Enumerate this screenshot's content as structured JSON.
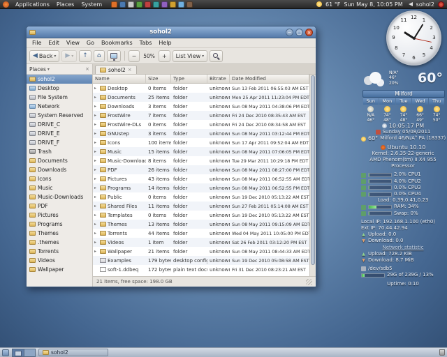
{
  "icons": {
    "minimize": "−",
    "maximize": "□",
    "close": "×",
    "expander": "▸",
    "back": "◀",
    "forward": "▶",
    "up": "↑",
    "home": "⌂",
    "zoom_out": "−",
    "zoom_in": "+",
    "dropdown": "▾",
    "tab_close": "×",
    "places_close": "×",
    "net_up": "▲",
    "net_down": "▼"
  },
  "top_panel": {
    "menus": [
      "Applications",
      "Places",
      "System"
    ],
    "app_icons": [
      {
        "name": "app-launcher-1",
        "color": "#e07028"
      },
      {
        "name": "app-launcher-2",
        "color": "#4a79b0"
      },
      {
        "name": "app-launcher-3",
        "color": "#c8c8c8"
      },
      {
        "name": "app-launcher-4",
        "color": "#58a040"
      },
      {
        "name": "app-launcher-5",
        "color": "#c04040"
      },
      {
        "name": "app-launcher-6",
        "color": "#38a0a0"
      },
      {
        "name": "app-launcher-7",
        "color": "#9060c0"
      },
      {
        "name": "app-launcher-8",
        "color": "#d0a030"
      },
      {
        "name": "app-launcher-9",
        "color": "#70b0e0"
      },
      {
        "name": "app-launcher-10",
        "color": "#806048"
      }
    ],
    "right": {
      "temperature": "61 °F",
      "clock": "Sun May 8, 10:05 PM",
      "user": "sohol2"
    }
  },
  "window": {
    "title": "sohol2",
    "menubar": [
      "File",
      "Edit",
      "View",
      "Go",
      "Bookmarks",
      "Tabs",
      "Help"
    ],
    "toolbar": {
      "back_label": "Back",
      "zoom_level": "50%",
      "view_mode": "List View"
    },
    "sidebar": {
      "header": "Places",
      "items": [
        {
          "label": "sohol2",
          "icon": "home",
          "selected": true
        },
        {
          "label": "Desktop",
          "icon": "desktop"
        },
        {
          "label": "File System",
          "icon": "drive"
        },
        {
          "label": "Network",
          "icon": "network"
        },
        {
          "label": "System Reserved",
          "icon": "drive"
        },
        {
          "label": "DRIVE_C",
          "icon": "drive"
        },
        {
          "label": "DRIVE_E",
          "icon": "drive"
        },
        {
          "label": "DRIVE_F",
          "icon": "drive"
        },
        {
          "label": "Trash",
          "icon": "trash"
        },
        {
          "label": "Documents",
          "icon": "folder"
        },
        {
          "label": "Downloads",
          "icon": "folder"
        },
        {
          "label": "Icons",
          "icon": "folder"
        },
        {
          "label": "Music",
          "icon": "folder"
        },
        {
          "label": "Music-Downloads",
          "icon": "folder"
        },
        {
          "label": "PDF",
          "icon": "folder"
        },
        {
          "label": "Pictures",
          "icon": "folder"
        },
        {
          "label": "Programs",
          "icon": "folder"
        },
        {
          "label": "Themes",
          "icon": "folder"
        },
        {
          "label": ".themes",
          "icon": "folder"
        },
        {
          "label": "Torrents",
          "icon": "folder"
        },
        {
          "label": "Videos",
          "icon": "folder"
        },
        {
          "label": "Wallpaper",
          "icon": "folder"
        }
      ]
    },
    "tab_label": "sohol2",
    "columns": [
      "Name",
      "Size",
      "Type",
      "Bitrate",
      "Date Modified"
    ],
    "rows": [
      {
        "name": "Desktop",
        "size": "0 items",
        "type": "folder",
        "bitrate": "unknown",
        "modified": "Sun 13 Feb 2011 06:55:03 AM EST",
        "icon": "folder"
      },
      {
        "name": "Documents",
        "size": "25 items",
        "type": "folder",
        "bitrate": "unknown",
        "modified": "Mon 25 Apr 2011 11:23:04 PM EDT",
        "icon": "folder"
      },
      {
        "name": "Downloads",
        "size": "3 items",
        "type": "folder",
        "bitrate": "unknown",
        "modified": "Sun 08 May 2011 04:38:06 PM EDT",
        "icon": "folder"
      },
      {
        "name": "FrostWire",
        "size": "7 items",
        "type": "folder",
        "bitrate": "unknown",
        "modified": "Fri 24 Dec 2010 08:35:43 AM EST",
        "icon": "folder"
      },
      {
        "name": "FrostWire-DLs",
        "size": "0 items",
        "type": "folder",
        "bitrate": "unknown",
        "modified": "Fri 24 Dec 2010 08:34:58 AM EST",
        "icon": "folder"
      },
      {
        "name": "GNUstep",
        "size": "3 items",
        "type": "folder",
        "bitrate": "unknown",
        "modified": "Sun 08 May 2011 03:12:44 PM EDT",
        "icon": "folder"
      },
      {
        "name": "Icons",
        "size": "100 items",
        "type": "folder",
        "bitrate": "unknown",
        "modified": "Sun 17 Apr 2011 09:52:04 AM EDT",
        "icon": "folder"
      },
      {
        "name": "Music",
        "size": "15 items",
        "type": "folder",
        "bitrate": "unknown",
        "modified": "Sun 08 May 2011 07:06:05 PM EDT",
        "icon": "folder"
      },
      {
        "name": "Music-Downloads",
        "size": "8 items",
        "type": "folder",
        "bitrate": "unknown",
        "modified": "Tue 29 Mar 2011 10:29:18 PM EDT",
        "icon": "folder"
      },
      {
        "name": "PDF",
        "size": "26 items",
        "type": "folder",
        "bitrate": "unknown",
        "modified": "Sun 08 May 2011 08:27:00 PM EDT",
        "icon": "folder"
      },
      {
        "name": "Pictures",
        "size": "43 items",
        "type": "folder",
        "bitrate": "unknown",
        "modified": "Sun 08 May 2011 06:52:55 AM EDT",
        "icon": "folder"
      },
      {
        "name": "Programs",
        "size": "14 items",
        "type": "folder",
        "bitrate": "unknown",
        "modified": "Sun 08 May 2011 06:52:55 PM EDT",
        "icon": "folder"
      },
      {
        "name": "Public",
        "size": "0 items",
        "type": "folder",
        "bitrate": "unknown",
        "modified": "Sun 19 Dec 2010 05:13:22 AM EST",
        "icon": "folder"
      },
      {
        "name": "Shared Files",
        "size": "11 items",
        "type": "folder",
        "bitrate": "unknown",
        "modified": "Sun 27 Feb 2011 05:14:08 AM EST",
        "icon": "folder"
      },
      {
        "name": "Templates",
        "size": "0 items",
        "type": "folder",
        "bitrate": "unknown",
        "modified": "Sun 19 Dec 2010 05:13:22 AM EST",
        "icon": "folder"
      },
      {
        "name": "Themes",
        "size": "13 items",
        "type": "folder",
        "bitrate": "unknown",
        "modified": "Sun 08 May 2011 09:15:09 AM EDT",
        "icon": "folder"
      },
      {
        "name": "Torrents",
        "size": "44 items",
        "type": "folder",
        "bitrate": "unknown",
        "modified": "Wed 04 May 2011 10:05:00 PM EDT",
        "icon": "folder"
      },
      {
        "name": "Videos",
        "size": "1 item",
        "type": "folder",
        "bitrate": "unknown",
        "modified": "Sat 26 Feb 2011 03:12:20 PM EST",
        "icon": "folder"
      },
      {
        "name": "Wallpaper",
        "size": "21 items",
        "type": "folder",
        "bitrate": "unknown",
        "modified": "Sun 08 May 2011 08:44:33 AM EDT",
        "icon": "folder"
      },
      {
        "name": "Examples",
        "size": "179 bytes",
        "type": "desktop configuration file",
        "bitrate": "unknown",
        "modified": "Sun 19 Dec 2010 05:08:58 AM EST",
        "icon": "config"
      },
      {
        "name": "soft-1.ddbeq",
        "size": "172 bytes",
        "type": "plain text document",
        "bitrate": "unknown",
        "modified": "Fri 31 Dec 2010 08:23:21 AM EST",
        "icon": "file"
      }
    ],
    "status": "21 items, free space: 198.0 GB"
  },
  "clock": {
    "numbers": [
      "12",
      "1",
      "2",
      "3",
      "4",
      "5",
      "6",
      "7",
      "8",
      "9",
      "10",
      "11"
    ]
  },
  "weather": {
    "temp": "60°",
    "aux1": "N/A°",
    "aux2": "46°",
    "aux3": "20%",
    "location": "Milford",
    "days": [
      {
        "name": "Sun",
        "icon": "moon",
        "hi": "N/A",
        "lo": "46°"
      },
      {
        "name": "Mon",
        "icon": "sun",
        "hi": "74°",
        "lo": "48°"
      },
      {
        "name": "Tue",
        "icon": "sun",
        "hi": "74°",
        "lo": "48°"
      },
      {
        "name": "Wed",
        "icon": "sun",
        "hi": "66°",
        "lo": "49°"
      },
      {
        "name": "Thu",
        "icon": "sun",
        "hi": "74°",
        "lo": "50°"
      }
    ]
  },
  "conky": {
    "time": "10:05:17 PM",
    "date": "Sunday 05/08/2011",
    "weather_temp": "60°",
    "weather_loc": "Milford 46/N/A° PA (18337)",
    "os": "Ubuntu 10.10",
    "kernel": "Kernel: 2.6.35-22-generic",
    "cpu_model": "AMD Phenom(tm) II X4 955",
    "cpu_model2": "Processor",
    "cpus": [
      {
        "text": "2.0% CPU1",
        "pct": 2
      },
      {
        "text": "4.0% CPU2",
        "pct": 4
      },
      {
        "text": "0.0% CPU3",
        "pct": 0
      },
      {
        "text": "0.0% CPU4",
        "pct": 0
      }
    ],
    "load": "Load: 0.39,0.41,0.23",
    "ram": {
      "label": "RAM: 34%",
      "pct": 34
    },
    "swap": {
      "label": "Swap: 0%",
      "pct": 0
    },
    "local_ip": "Local IP: 192.168.1.100 (eth0)",
    "ext_ip": "Ext IP: 70.44.42.94",
    "upload": "Upload: 0.0",
    "download": "Download: 0.0",
    "net_header": "Network statistic",
    "upload_total": "Upload: 728.2 KiB",
    "download_total": "Download: 8.7 MiB",
    "disk": "/dev/sdb5",
    "disk_usage": {
      "label": "29G of 239G / 13%",
      "pct": 13
    },
    "uptime": "Uptime: 0:10"
  },
  "bottom_panel": {
    "taskbar": [
      {
        "label": "sohol2"
      }
    ]
  }
}
